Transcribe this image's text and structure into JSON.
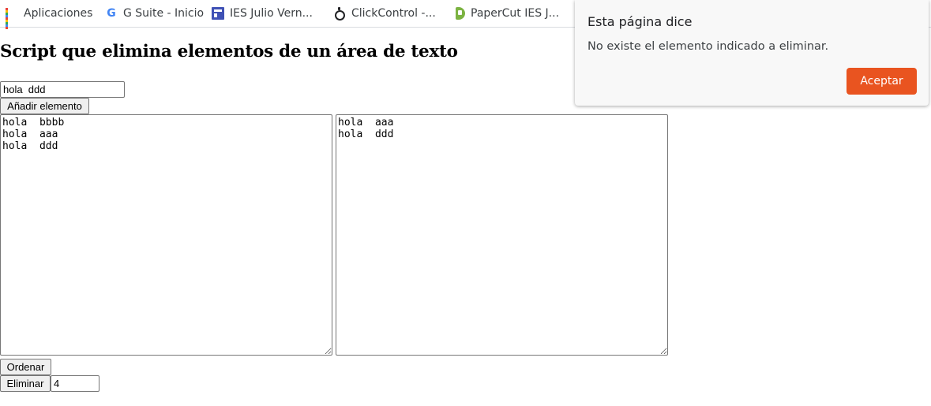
{
  "bookmarks": [
    {
      "label": "Aplicaciones",
      "icon": "apps-grid-icon"
    },
    {
      "label": "G Suite - Inicio",
      "icon": "google-g-icon"
    },
    {
      "label": "IES Julio Vern...",
      "icon": "ies-julio-verne-icon"
    },
    {
      "label": "ClickControl -...",
      "icon": "clickcontrol-icon"
    },
    {
      "label": "PaperCut IES J...",
      "icon": "papercut-icon"
    }
  ],
  "page": {
    "title": "Script que elimina elementos de un área de texto",
    "add_input_value": "hola  ddd",
    "add_button_label": "Añadir elemento",
    "textarea_left_value": "hola  bbbb\nhola  aaa\nhola  ddd",
    "textarea_right_value": "hola  aaa\nhola  ddd",
    "sort_button_label": "Ordenar",
    "delete_button_label": "Eliminar",
    "delete_index_value": "4"
  },
  "dialog": {
    "title": "Esta página dice",
    "message": "No existe el elemento indicado a eliminar.",
    "ok_label": "Aceptar",
    "accent_color": "#e95420"
  }
}
